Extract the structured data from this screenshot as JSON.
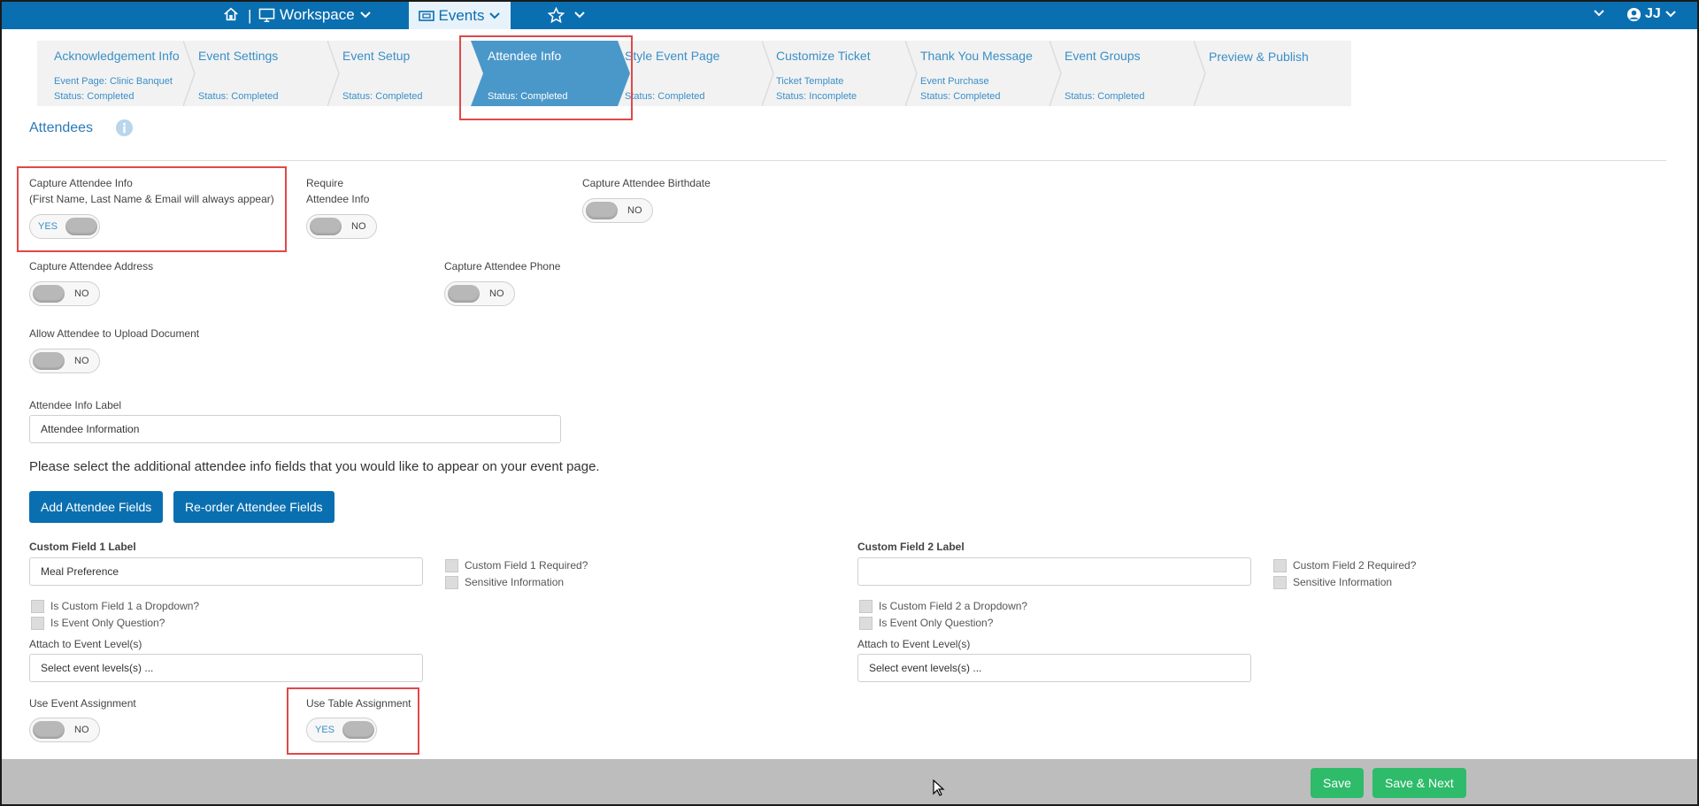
{
  "topbar": {
    "separator": "|",
    "workspace_label": "Workspace",
    "events_label": "Events",
    "user_initials": "JJ"
  },
  "wizard": {
    "steps": [
      {
        "label": "Acknowledgement Info",
        "sub": "Event Page: Clinic Banquet",
        "status": "Status: Completed"
      },
      {
        "label": "Event Settings",
        "sub": "",
        "status": "Status: Completed"
      },
      {
        "label": "Event Setup",
        "sub": "",
        "status": "Status: Completed"
      },
      {
        "label": "Attendee Info",
        "sub": "",
        "status": "Status: Completed"
      },
      {
        "label": "Style Event Page",
        "sub": "",
        "status": "Status: Completed"
      },
      {
        "label": "Customize Ticket",
        "sub": "Ticket Template",
        "status": "Status: Incomplete"
      },
      {
        "label": "Thank You Message",
        "sub": "Event Purchase",
        "status": "Status: Completed"
      },
      {
        "label": "Event Groups",
        "sub": "",
        "status": "Status: Completed"
      },
      {
        "label": "Preview & Publish",
        "sub": "",
        "status": ""
      }
    ]
  },
  "section": {
    "title": "Attendees"
  },
  "settings": {
    "capture_info_label": "Capture Attendee Info",
    "capture_info_note": "(First Name, Last Name & Email will always appear)",
    "capture_info_value": "YES",
    "require_label_1": "Require",
    "require_label_2": "Attendee Info",
    "require_value": "NO",
    "birthdate_label": "Capture Attendee Birthdate",
    "birthdate_value": "NO",
    "address_label": "Capture Attendee Address",
    "address_value": "NO",
    "phone_label": "Capture Attendee Phone",
    "phone_value": "NO",
    "upload_label": "Allow Attendee to Upload Document",
    "upload_value": "NO",
    "info_label_label": "Attendee Info Label",
    "info_label_value": "Attendee Information"
  },
  "instruction": "Please select the additional attendee info fields that you would like to appear on your event page.",
  "buttons": {
    "add_fields": "Add Attendee Fields",
    "reorder_fields": "Re-order Attendee Fields",
    "save": "Save",
    "save_next": "Save & Next"
  },
  "custom_field_1": {
    "label": "Custom Field 1 Label",
    "value": "Meal Preference",
    "required": "Custom Field 1 Required?",
    "sensitive": "Sensitive Information",
    "dropdown": "Is Custom Field 1 a Dropdown?",
    "event_only": "Is Event Only Question?",
    "attach_label": "Attach to Event Level(s)",
    "attach_placeholder": "Select event levels(s) ..."
  },
  "custom_field_2": {
    "label": "Custom Field 2 Label",
    "value": "",
    "required": "Custom Field 2 Required?",
    "sensitive": "Sensitive Information",
    "dropdown": "Is Custom Field 2 a Dropdown?",
    "event_only": "Is Event Only Question?",
    "attach_label": "Attach to Event Level(s)",
    "attach_placeholder": "Select event levels(s) ..."
  },
  "assignment": {
    "event_label": "Use Event Assignment",
    "event_value": "NO",
    "table_label": "Use Table Assignment",
    "table_value": "YES"
  },
  "colors": {
    "brand_blue": "#0a6fb0",
    "active_step": "#4a98c9",
    "save_green": "#2ebb6a",
    "highlight_red": "#e04848"
  }
}
